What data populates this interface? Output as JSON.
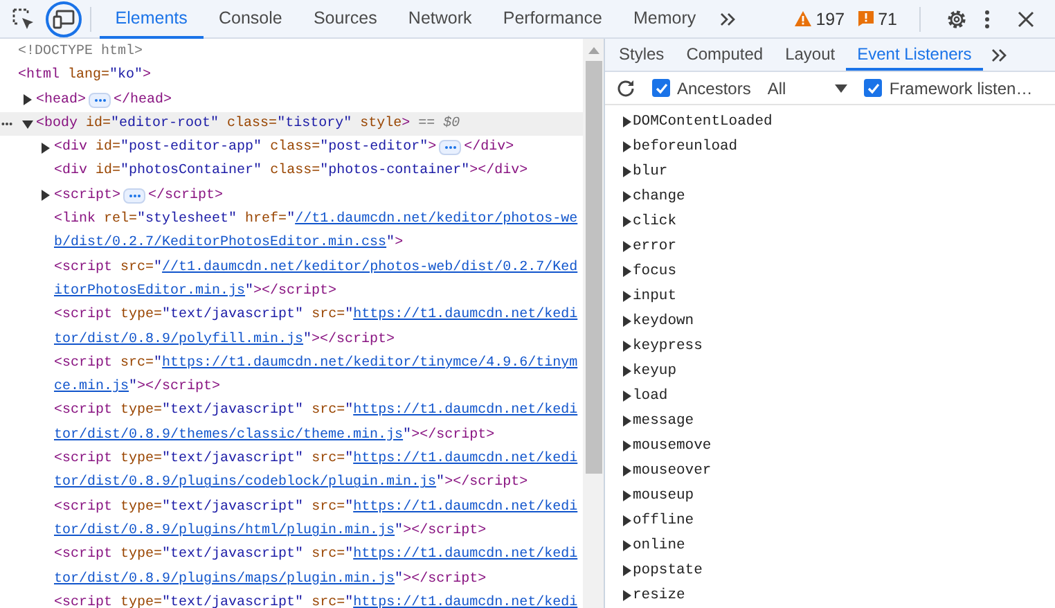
{
  "toolbar": {
    "device_button": {
      "focused": true
    },
    "tabs": [
      {
        "label": "Elements",
        "selected": true
      },
      {
        "label": "Console",
        "selected": false
      },
      {
        "label": "Sources",
        "selected": false
      },
      {
        "label": "Network",
        "selected": false
      },
      {
        "label": "Performance",
        "selected": false
      },
      {
        "label": "Memory",
        "selected": false
      }
    ],
    "warnings": "197",
    "errors": "71"
  },
  "elements": [
    {
      "lines": [
        [
          {
            "kind": "doctype",
            "text": "<!DOCTYPE html>"
          }
        ]
      ]
    },
    {
      "lines": [
        [
          {
            "kind": "tag",
            "text": "<html"
          },
          {
            "kind": "attr",
            "text": " lang="
          },
          {
            "kind": "value",
            "text": "\"ko\""
          },
          {
            "kind": "tag",
            "text": ">"
          }
        ]
      ],
      "children": [
        {
          "expanded": false,
          "selected": false,
          "lines": [
            [
              {
                "kind": "tag",
                "text": "<head>"
              },
              {
                "kind": "badge"
              },
              {
                "kind": "tag",
                "text": "</head>"
              }
            ]
          ]
        },
        {
          "expanded": true,
          "selected": true,
          "lines": [
            [
              {
                "kind": "tag",
                "text": "<body"
              },
              {
                "kind": "attr",
                "text": " id="
              },
              {
                "kind": "value",
                "text": "\"editor-root\""
              },
              {
                "kind": "attr",
                "text": " class="
              },
              {
                "kind": "value",
                "text": "\"tistory\""
              },
              {
                "kind": "attr",
                "text": " style"
              },
              {
                "kind": "tag",
                "text": ">"
              },
              {
                "kind": "marker",
                "text": "== $0"
              }
            ]
          ],
          "children": [
            {
              "expanded": false,
              "lines": [
                [
                  {
                    "kind": "tag",
                    "text": "<div"
                  },
                  {
                    "kind": "attr",
                    "text": " id="
                  },
                  {
                    "kind": "value",
                    "text": "\"post-editor-app\""
                  },
                  {
                    "kind": "attr",
                    "text": " class="
                  },
                  {
                    "kind": "value",
                    "text": "\"post-editor\""
                  },
                  {
                    "kind": "tag",
                    "text": ">"
                  },
                  {
                    "kind": "badge"
                  },
                  {
                    "kind": "tag",
                    "text": "</div>"
                  }
                ]
              ]
            },
            {
              "lines": [
                [
                  {
                    "kind": "tag",
                    "text": "<div"
                  },
                  {
                    "kind": "attr",
                    "text": " id="
                  },
                  {
                    "kind": "value",
                    "text": "\"photosContainer\""
                  },
                  {
                    "kind": "attr",
                    "text": " class="
                  },
                  {
                    "kind": "value",
                    "text": "\"photos-container\""
                  },
                  {
                    "kind": "tag",
                    "text": "></div>"
                  }
                ]
              ]
            },
            {
              "expanded": false,
              "lines": [
                [
                  {
                    "kind": "tag",
                    "text": "<script>"
                  },
                  {
                    "kind": "badge"
                  },
                  {
                    "kind": "tag",
                    "text": "</script>"
                  }
                ]
              ]
            },
            {
              "lines": [
                [
                  {
                    "kind": "tag",
                    "text": "<link"
                  },
                  {
                    "kind": "attr",
                    "text": " rel="
                  },
                  {
                    "kind": "value",
                    "text": "\"stylesheet\""
                  },
                  {
                    "kind": "attr",
                    "text": " href="
                  },
                  {
                    "kind": "value",
                    "text": "\""
                  },
                  {
                    "kind": "link",
                    "text": "//t1.daumcdn.net/keditor/photos-we"
                  }
                ],
                [
                  {
                    "kind": "link",
                    "text": "b/dist/0.2.7/KeditorPhotosEditor.min.css"
                  },
                  {
                    "kind": "value",
                    "text": "\""
                  },
                  {
                    "kind": "tag",
                    "text": ">"
                  }
                ]
              ]
            },
            {
              "lines": [
                [
                  {
                    "kind": "tag",
                    "text": "<script"
                  },
                  {
                    "kind": "attr",
                    "text": " src="
                  },
                  {
                    "kind": "value",
                    "text": "\""
                  },
                  {
                    "kind": "link",
                    "text": "//t1.daumcdn.net/keditor/photos-web/dist/0.2.7/Ked"
                  }
                ],
                [
                  {
                    "kind": "link",
                    "text": "itorPhotosEditor.min.js"
                  },
                  {
                    "kind": "value",
                    "text": "\""
                  },
                  {
                    "kind": "tag",
                    "text": "></script>"
                  }
                ]
              ]
            },
            {
              "lines": [
                [
                  {
                    "kind": "tag",
                    "text": "<script"
                  },
                  {
                    "kind": "attr",
                    "text": " type="
                  },
                  {
                    "kind": "value",
                    "text": "\"text/javascript\""
                  },
                  {
                    "kind": "attr",
                    "text": " src="
                  },
                  {
                    "kind": "value",
                    "text": "\""
                  },
                  {
                    "kind": "link",
                    "text": "https://t1.daumcdn.net/kedi"
                  }
                ],
                [
                  {
                    "kind": "link",
                    "text": "tor/dist/0.8.9/polyfill.min.js"
                  },
                  {
                    "kind": "value",
                    "text": "\""
                  },
                  {
                    "kind": "tag",
                    "text": "></script>"
                  }
                ]
              ]
            },
            {
              "lines": [
                [
                  {
                    "kind": "tag",
                    "text": "<script"
                  },
                  {
                    "kind": "attr",
                    "text": " src="
                  },
                  {
                    "kind": "value",
                    "text": "\""
                  },
                  {
                    "kind": "link",
                    "text": "https://t1.daumcdn.net/keditor/tinymce/4.9.6/tinym"
                  }
                ],
                [
                  {
                    "kind": "link",
                    "text": "ce.min.js"
                  },
                  {
                    "kind": "value",
                    "text": "\""
                  },
                  {
                    "kind": "tag",
                    "text": "></script>"
                  }
                ]
              ]
            },
            {
              "lines": [
                [
                  {
                    "kind": "tag",
                    "text": "<script"
                  },
                  {
                    "kind": "attr",
                    "text": " type="
                  },
                  {
                    "kind": "value",
                    "text": "\"text/javascript\""
                  },
                  {
                    "kind": "attr",
                    "text": " src="
                  },
                  {
                    "kind": "value",
                    "text": "\""
                  },
                  {
                    "kind": "link",
                    "text": "https://t1.daumcdn.net/kedi"
                  }
                ],
                [
                  {
                    "kind": "link",
                    "text": "tor/dist/0.8.9/themes/classic/theme.min.js"
                  },
                  {
                    "kind": "value",
                    "text": "\""
                  },
                  {
                    "kind": "tag",
                    "text": "></script>"
                  }
                ]
              ]
            },
            {
              "lines": [
                [
                  {
                    "kind": "tag",
                    "text": "<script"
                  },
                  {
                    "kind": "attr",
                    "text": " type="
                  },
                  {
                    "kind": "value",
                    "text": "\"text/javascript\""
                  },
                  {
                    "kind": "attr",
                    "text": " src="
                  },
                  {
                    "kind": "value",
                    "text": "\""
                  },
                  {
                    "kind": "link",
                    "text": "https://t1.daumcdn.net/kedi"
                  }
                ],
                [
                  {
                    "kind": "link",
                    "text": "tor/dist/0.8.9/plugins/codeblock/plugin.min.js"
                  },
                  {
                    "kind": "value",
                    "text": "\""
                  },
                  {
                    "kind": "tag",
                    "text": "></script>"
                  }
                ]
              ]
            },
            {
              "lines": [
                [
                  {
                    "kind": "tag",
                    "text": "<script"
                  },
                  {
                    "kind": "attr",
                    "text": " type="
                  },
                  {
                    "kind": "value",
                    "text": "\"text/javascript\""
                  },
                  {
                    "kind": "attr",
                    "text": " src="
                  },
                  {
                    "kind": "value",
                    "text": "\""
                  },
                  {
                    "kind": "link",
                    "text": "https://t1.daumcdn.net/kedi"
                  }
                ],
                [
                  {
                    "kind": "link",
                    "text": "tor/dist/0.8.9/plugins/html/plugin.min.js"
                  },
                  {
                    "kind": "value",
                    "text": "\""
                  },
                  {
                    "kind": "tag",
                    "text": "></script>"
                  }
                ]
              ]
            },
            {
              "lines": [
                [
                  {
                    "kind": "tag",
                    "text": "<script"
                  },
                  {
                    "kind": "attr",
                    "text": " type="
                  },
                  {
                    "kind": "value",
                    "text": "\"text/javascript\""
                  },
                  {
                    "kind": "attr",
                    "text": " src="
                  },
                  {
                    "kind": "value",
                    "text": "\""
                  },
                  {
                    "kind": "link",
                    "text": "https://t1.daumcdn.net/kedi"
                  }
                ],
                [
                  {
                    "kind": "link",
                    "text": "tor/dist/0.8.9/plugins/maps/plugin.min.js"
                  },
                  {
                    "kind": "value",
                    "text": "\""
                  },
                  {
                    "kind": "tag",
                    "text": "></script>"
                  }
                ]
              ]
            },
            {
              "lines": [
                [
                  {
                    "kind": "tag",
                    "text": "<script"
                  },
                  {
                    "kind": "attr",
                    "text": " type="
                  },
                  {
                    "kind": "value",
                    "text": "\"text/javascript\""
                  },
                  {
                    "kind": "attr",
                    "text": " src="
                  },
                  {
                    "kind": "value",
                    "text": "\""
                  },
                  {
                    "kind": "link",
                    "text": "https://t1.daumcdn.net/kedi"
                  }
                ]
              ]
            }
          ]
        }
      ]
    }
  ],
  "sidebar": {
    "tabs": [
      {
        "label": "Styles",
        "selected": false
      },
      {
        "label": "Computed",
        "selected": false
      },
      {
        "label": "Layout",
        "selected": false
      },
      {
        "label": "Event Listeners",
        "selected": true
      }
    ],
    "ancestors": {
      "label": "Ancestors",
      "checked": true
    },
    "dropdown": "All",
    "framework": {
      "label": "Framework listen…",
      "checked": true
    },
    "events": [
      "DOMContentLoaded",
      "beforeunload",
      "blur",
      "change",
      "click",
      "error",
      "focus",
      "input",
      "keydown",
      "keypress",
      "keyup",
      "load",
      "message",
      "mousemove",
      "mouseover",
      "mouseup",
      "offline",
      "online",
      "popstate",
      "resize"
    ]
  }
}
